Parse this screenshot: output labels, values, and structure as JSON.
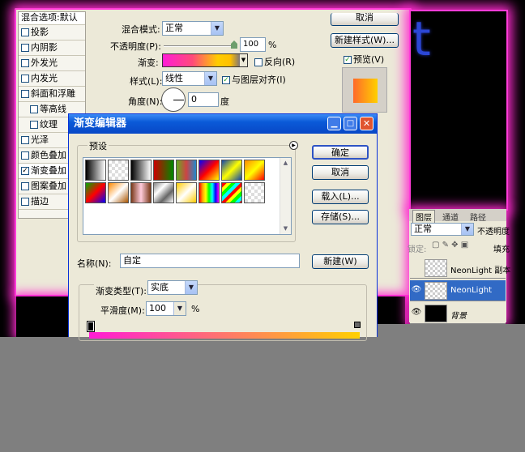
{
  "canvas": {
    "title_fragment": "t"
  },
  "style_list": {
    "header": "混合选项:默认",
    "items": [
      {
        "label": "投影",
        "checked": false,
        "indent": false
      },
      {
        "label": "内阴影",
        "checked": false,
        "indent": false
      },
      {
        "label": "外发光",
        "checked": false,
        "indent": false
      },
      {
        "label": "内发光",
        "checked": false,
        "indent": false
      },
      {
        "label": "斜面和浮雕",
        "checked": false,
        "indent": false
      },
      {
        "label": "等高线",
        "checked": false,
        "indent": true
      },
      {
        "label": "纹理",
        "checked": false,
        "indent": true
      },
      {
        "label": "光泽",
        "checked": false,
        "indent": false
      },
      {
        "label": "颜色叠加",
        "checked": false,
        "indent": false
      },
      {
        "label": "渐变叠加",
        "checked": true,
        "indent": false
      },
      {
        "label": "图案叠加",
        "checked": false,
        "indent": false
      },
      {
        "label": "描边",
        "checked": false,
        "indent": false
      }
    ]
  },
  "gradient_overlay": {
    "blend_mode_label": "混合模式:",
    "blend_mode_value": "正常",
    "opacity_label": "不透明度(P):",
    "opacity_value": "100",
    "opacity_unit": "%",
    "gradient_label": "渐变:",
    "reverse_label": "反向(R)",
    "style_label": "样式(L):",
    "style_value": "线性",
    "align_label": "与图层对齐(I)",
    "angle_label": "角度(N):",
    "angle_value": "0",
    "angle_unit": "度"
  },
  "layer_style_buttons": {
    "cancel": "取消",
    "new_style": "新建样式(W)...",
    "preview": "预览(V)"
  },
  "gradient_editor": {
    "title": "渐变编辑器",
    "presets_label": "预设",
    "ok": "确定",
    "cancel": "取消",
    "load": "载入(L)...",
    "save": "存储(S)...",
    "name_label": "名称(N):",
    "name_value": "自定",
    "new_button": "新建(W)",
    "type_label": "渐变类型(T):",
    "type_value": "实底",
    "smoothness_label": "平滑度(M):",
    "smoothness_value": "100",
    "smoothness_unit": "%"
  },
  "layers_panel": {
    "tabs": [
      "图层",
      "通道",
      "路径"
    ],
    "blend_value": "正常",
    "opacity_label": "不透明度",
    "lock_label": "锁定:",
    "fill_label": "填充",
    "layers": [
      {
        "name": "NeonLight 副本",
        "visible": false,
        "selected": false
      },
      {
        "name": "NeonLight",
        "visible": true,
        "selected": true
      },
      {
        "name": "背景",
        "visible": true,
        "selected": false
      }
    ]
  }
}
